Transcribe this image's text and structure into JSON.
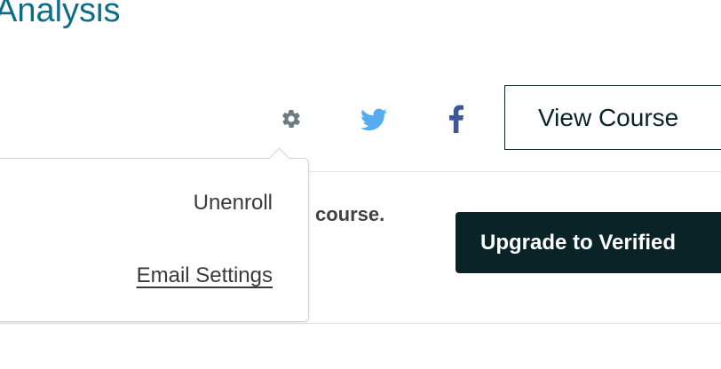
{
  "course": {
    "title": "Analysis"
  },
  "actions": {
    "settings_icon": "gear-icon",
    "twitter_icon": "twitter-icon",
    "facebook_icon": "facebook-icon",
    "view_course_label": "View Course"
  },
  "notice": {
    "message": "course.",
    "upgrade_label": "Upgrade to Verified"
  },
  "dropdown": {
    "items": [
      {
        "label": "Unenroll"
      },
      {
        "label": "Email Settings"
      }
    ]
  },
  "colors": {
    "title": "#0b6d8c",
    "dark": "#0a2327",
    "twitter": "#55acee",
    "facebook": "#3b5998",
    "gear": "#6f7b83"
  }
}
